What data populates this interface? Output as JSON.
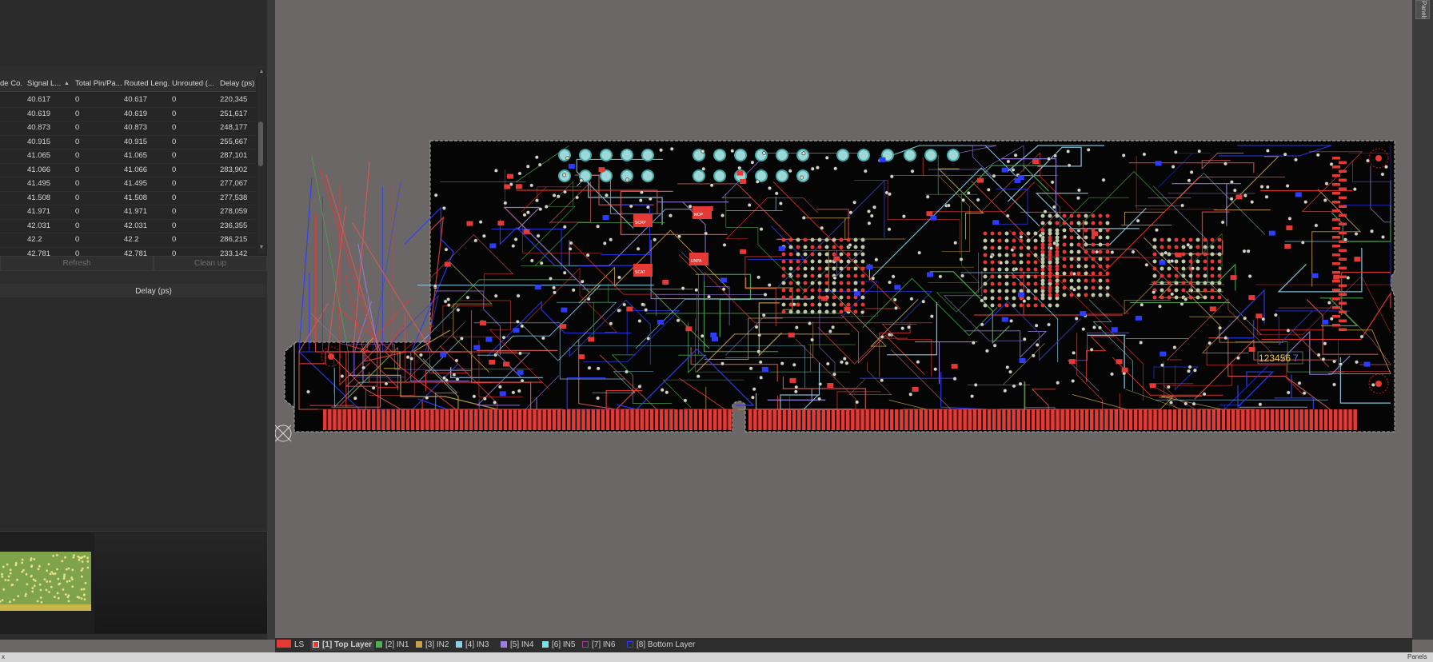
{
  "grid": {
    "columns": [
      "de Co...",
      "Signal L...",
      "Total Pin/Pa...",
      "Routed Leng...",
      "Unrouted (...",
      "Delay (ps)"
    ],
    "rows": [
      [
        "40.617",
        "0",
        "40.617",
        "0",
        "220,345"
      ],
      [
        "40.619",
        "0",
        "40.619",
        "0",
        "251,617"
      ],
      [
        "40.873",
        "0",
        "40.873",
        "0",
        "248,177"
      ],
      [
        "40.915",
        "0",
        "40.915",
        "0",
        "255,667"
      ],
      [
        "41.065",
        "0",
        "41.065",
        "0",
        "287,101"
      ],
      [
        "41.066",
        "0",
        "41.066",
        "0",
        "283,902"
      ],
      [
        "41.495",
        "0",
        "41.495",
        "0",
        "277,067"
      ],
      [
        "41.508",
        "0",
        "41.508",
        "0",
        "277,538"
      ],
      [
        "41.971",
        "0",
        "41.971",
        "0",
        "278,059"
      ],
      [
        "42.031",
        "0",
        "42.031",
        "0",
        "236,355"
      ],
      [
        "42.2",
        "0",
        "42.2",
        "0",
        "286,215"
      ],
      [
        "42.781",
        "0",
        "42.781",
        "0",
        "233,142"
      ]
    ],
    "refresh_label": "Refresh",
    "cleanup_label": "Clean up",
    "sort_column": "Signal L..."
  },
  "delay_header": "Delay (ps)",
  "board_text": "123456",
  "board_text_tail": "7",
  "board_labels": [
    "SCRP",
    "MDP",
    "SCAT",
    "UNPA"
  ],
  "panels_label": "Panels",
  "layers": [
    {
      "label": "LS",
      "color": "#e53935"
    },
    {
      "label": "[1] Top Layer",
      "color": "#e53935"
    },
    {
      "label": "[2] IN1",
      "color": "#4caf50"
    },
    {
      "label": "[3] IN2",
      "color": "#c8a24a"
    },
    {
      "label": "[4] IN3",
      "color": "#8fd0e8"
    },
    {
      "label": "[5] IN4",
      "color": "#9b7ee0"
    },
    {
      "label": "[6] IN5",
      "color": "#7fe0e8"
    },
    {
      "label": "[7] IN6",
      "color": "#a040a0"
    },
    {
      "label": "[8] Bottom Layer",
      "color": "#2c3cff"
    }
  ],
  "active_layer": "[1] Top Layer",
  "status_left": "x",
  "status_right": "Panels"
}
